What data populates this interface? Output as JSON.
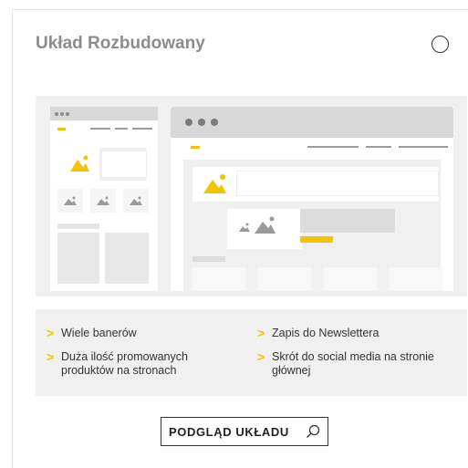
{
  "layout": {
    "title": "Układ Rozbudowany",
    "features": [
      "Wiele banerów",
      "Zapis do Newslettera",
      "Duża ilość promowanych produktów na stronach",
      "Skrót do social media na stronie głównej"
    ],
    "button_label": "PODGLĄD UKŁADU"
  },
  "icons": {
    "feature_bullet": "chevron-right-icon",
    "button": "search-icon",
    "image_placeholder": "image-icon"
  },
  "colors": {
    "accent": "#f5c400",
    "title": "#8c8c8c",
    "panel_bg": "#f0f0f0"
  }
}
